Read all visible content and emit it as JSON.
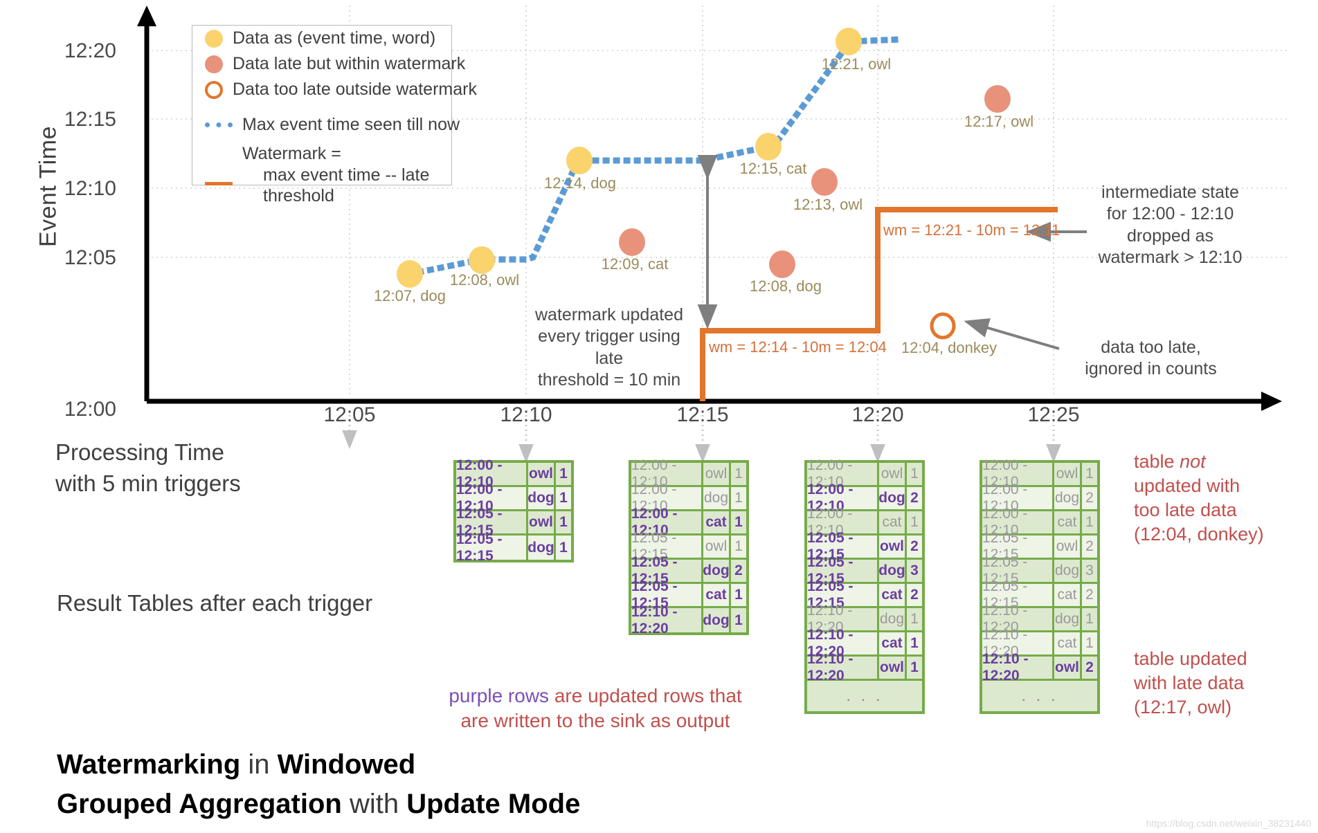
{
  "axes": {
    "y_title": "Event Time",
    "y_ticks": [
      "12:20",
      "12:15",
      "12:10",
      "12:05",
      "12:00"
    ],
    "x_ticks": [
      "12:05",
      "12:10",
      "12:15",
      "12:20",
      "12:25"
    ],
    "x_label_line1": "Processing Time",
    "x_label_line2": "with 5 min triggers"
  },
  "legend": {
    "items": [
      {
        "marker": "yellow-dot-icon",
        "label": "Data as (event time, word)"
      },
      {
        "marker": "salmon-dot-icon",
        "label": "Data late but within watermark"
      },
      {
        "marker": "hollow-orange-dot-icon",
        "label": "Data too late outside watermark"
      },
      {
        "marker": "blue-dotted-line-icon",
        "label": "Max event time seen till now"
      },
      {
        "marker": "orange-solid-line-icon",
        "label": "Watermark =",
        "label2": "max event time -- late threshold"
      }
    ]
  },
  "chart_data": {
    "type": "scatter",
    "title": "Watermarking in Windowed Grouped Aggregation with Update Mode",
    "xlabel": "Processing Time with 5 min triggers",
    "ylabel": "Event Time",
    "xlim": [
      "12:00",
      "12:27"
    ],
    "ylim": [
      "12:00",
      "12:22"
    ],
    "grid": true,
    "points": [
      {
        "label": "12:07, dog",
        "processing_time": "12:06",
        "event_time": "12:07",
        "kind": "on-time"
      },
      {
        "label": "12:08, owl",
        "processing_time": "12:08",
        "event_time": "12:08",
        "kind": "on-time"
      },
      {
        "label": "12:14, dog",
        "processing_time": "12:11",
        "event_time": "12:14",
        "kind": "on-time"
      },
      {
        "label": "12:09, cat",
        "processing_time": "12:13",
        "event_time": "12:09",
        "kind": "late-within-watermark"
      },
      {
        "label": "12:15, cat",
        "processing_time": "12:16",
        "event_time": "12:15",
        "kind": "on-time"
      },
      {
        "label": "12:13, owl",
        "processing_time": "12:18",
        "event_time": "12:13",
        "kind": "late-within-watermark"
      },
      {
        "label": "12:08, dog",
        "processing_time": "12:17",
        "event_time": "12:08",
        "kind": "late-within-watermark"
      },
      {
        "label": "12:21, owl",
        "processing_time": "12:19.5",
        "event_time": "12:21",
        "kind": "on-time"
      },
      {
        "label": "12:17, owl",
        "processing_time": "12:23",
        "event_time": "12:17",
        "kind": "late-within-watermark"
      },
      {
        "label": "12:04, donkey",
        "processing_time": "12:22",
        "event_time": "12:04",
        "kind": "too-late"
      }
    ],
    "series": [
      {
        "name": "Max event time seen till now",
        "style": "blue dotted",
        "x": [
          "12:06",
          "12:08",
          "12:10",
          "12:11",
          "12:16",
          "12:16",
          "12:19.5",
          "12:20.5"
        ],
        "y": [
          "12:07",
          "12:08",
          "12:08",
          "12:14",
          "12:14",
          "12:15",
          "12:21",
          "12:21"
        ]
      },
      {
        "name": "Watermark = max event time -- late threshold",
        "style": "orange step",
        "x": [
          "12:15",
          "12:20",
          "12:20",
          "12:25.5"
        ],
        "y": [
          "12:00",
          "12:04",
          "12:11",
          "12:11"
        ]
      }
    ],
    "annotations": [
      {
        "name": "watermark-label-1",
        "text": "wm = 12:14 - 10m = 12:04"
      },
      {
        "name": "watermark-label-2",
        "text": "wm = 12:21 - 10m = 12:11"
      },
      {
        "name": "watermark-update-note",
        "lines": [
          "watermark updated",
          "every trigger using late",
          "threshold = 10 min"
        ]
      },
      {
        "name": "intermediate-state-note",
        "lines": [
          "intermediate state",
          "for 12:00 - 12:10",
          "dropped as",
          "watermark > 12:10"
        ]
      },
      {
        "name": "too-late-note",
        "lines": [
          "data too late,",
          "ignored in counts"
        ]
      }
    ]
  },
  "tables": {
    "section_label": "Result Tables after each trigger",
    "legend_note": {
      "purple": "purple rows",
      "rest_line1": " are updated rows that",
      "line2": "are written to the sink as output"
    },
    "ellipsis": ". . .",
    "list": [
      {
        "name": "result-table-trigger-1",
        "rows": [
          {
            "window": "12:00 - 12:10",
            "word": "owl",
            "count": "1",
            "state": "updated"
          },
          {
            "window": "12:00 - 12:10",
            "word": "dog",
            "count": "1",
            "state": "updated"
          },
          {
            "window": "12:05 - 12:15",
            "word": "owl",
            "count": "1",
            "state": "updated"
          },
          {
            "window": "12:05 - 12:15",
            "word": "dog",
            "count": "1",
            "state": "updated"
          }
        ],
        "has_ellipsis": false
      },
      {
        "name": "result-table-trigger-2",
        "rows": [
          {
            "window": "12:00 - 12:10",
            "word": "owl",
            "count": "1",
            "state": "stale"
          },
          {
            "window": "12:00 - 12:10",
            "word": "dog",
            "count": "1",
            "state": "stale"
          },
          {
            "window": "12:00 - 12:10",
            "word": "cat",
            "count": "1",
            "state": "updated"
          },
          {
            "window": "12:05 - 12:15",
            "word": "owl",
            "count": "1",
            "state": "stale"
          },
          {
            "window": "12:05 - 12:15",
            "word": "dog",
            "count": "2",
            "state": "updated"
          },
          {
            "window": "12:05 - 12:15",
            "word": "cat",
            "count": "1",
            "state": "updated"
          },
          {
            "window": "12:10 - 12:20",
            "word": "dog",
            "count": "1",
            "state": "updated"
          }
        ],
        "has_ellipsis": false
      },
      {
        "name": "result-table-trigger-3",
        "rows": [
          {
            "window": "12:00 - 12:10",
            "word": "owl",
            "count": "1",
            "state": "stale"
          },
          {
            "window": "12:00 - 12:10",
            "word": "dog",
            "count": "2",
            "state": "updated"
          },
          {
            "window": "12:00 - 12:10",
            "word": "cat",
            "count": "1",
            "state": "stale"
          },
          {
            "window": "12:05 - 12:15",
            "word": "owl",
            "count": "2",
            "state": "updated"
          },
          {
            "window": "12:05 - 12:15",
            "word": "dog",
            "count": "3",
            "state": "updated"
          },
          {
            "window": "12:05 - 12:15",
            "word": "cat",
            "count": "2",
            "state": "updated"
          },
          {
            "window": "12:10 - 12:20",
            "word": "dog",
            "count": "1",
            "state": "stale"
          },
          {
            "window": "12:10 - 12:20",
            "word": "cat",
            "count": "1",
            "state": "updated"
          },
          {
            "window": "12:10 - 12:20",
            "word": "owl",
            "count": "1",
            "state": "updated"
          }
        ],
        "has_ellipsis": true
      },
      {
        "name": "result-table-trigger-4",
        "rows": [
          {
            "window": "12:00 - 12:10",
            "word": "owl",
            "count": "1",
            "state": "stale"
          },
          {
            "window": "12:00 - 12:10",
            "word": "dog",
            "count": "2",
            "state": "stale"
          },
          {
            "window": "12:00 - 12:10",
            "word": "cat",
            "count": "1",
            "state": "stale"
          },
          {
            "window": "12:05 - 12:15",
            "word": "owl",
            "count": "2",
            "state": "stale"
          },
          {
            "window": "12:05 - 12:15",
            "word": "dog",
            "count": "3",
            "state": "stale"
          },
          {
            "window": "12:05 - 12:15",
            "word": "cat",
            "count": "2",
            "state": "stale"
          },
          {
            "window": "12:10 - 12:20",
            "word": "dog",
            "count": "1",
            "state": "stale"
          },
          {
            "window": "12:10 - 12:20",
            "word": "cat",
            "count": "1",
            "state": "stale"
          },
          {
            "window": "12:10 - 12:20",
            "word": "owl",
            "count": "2",
            "state": "updated"
          }
        ],
        "has_ellipsis": true
      }
    ]
  },
  "side_notes": {
    "not_updated": {
      "line1_a": "table ",
      "line1_i": "not",
      "line2": "updated with",
      "line3": "too late data",
      "line4": "(12:04, donkey)"
    },
    "updated": {
      "line1": "table updated",
      "line2": "with late data",
      "line3": "(12:17, owl)"
    }
  },
  "caption": {
    "line1_bold": "Watermarking",
    "line1_thin": " in ",
    "line1_bold2": "Windowed",
    "line2_bold": "Grouped Aggregation",
    "line2_thin": " with ",
    "line2_bold2": "Update Mode"
  },
  "footer": {
    "url": "https://blog.csdn.net/weixin_38231440"
  },
  "colors": {
    "yellow": "#fad36d",
    "salmon": "#e8927c",
    "orange": "#e2762d",
    "blue": "#5b9bd5",
    "green": "#76ab49",
    "purple": "#6b3fa0",
    "red": "#c0504d",
    "gray": "#808080"
  }
}
